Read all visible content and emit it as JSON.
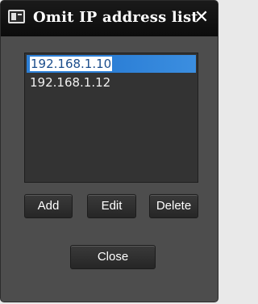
{
  "window": {
    "title": "Omit IP address list",
    "app_icon": "window-icon",
    "close_glyph": "✕"
  },
  "list": {
    "items": [
      {
        "label": "192.168.1.10",
        "selected": true
      },
      {
        "label": "192.168.1.12",
        "selected": false
      }
    ]
  },
  "buttons": {
    "add": "Add",
    "edit": "Edit",
    "delete": "Delete",
    "close": "Close"
  },
  "colors": {
    "selection": "#2c7fd6",
    "window_bg": "#4d4d4d",
    "titlebar_bg": "#111111"
  }
}
